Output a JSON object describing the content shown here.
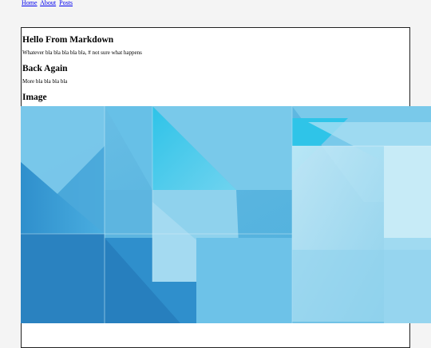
{
  "nav": {
    "links": [
      "Home",
      "About",
      "Posts"
    ]
  },
  "post": {
    "heading1": "Hello From Markdown",
    "paragraph1": "Whatever bla bla bla bla bla, # not sure what happens",
    "heading2": "Back Again",
    "paragraph2": "More bla bla bla bla",
    "heading3": "Image"
  },
  "image": {
    "icon": "abstract-geometric-blue-image",
    "colors": {
      "base": "#58b4df",
      "light": "#8fd2ed",
      "pale": "#bfe7f6",
      "deep": "#2e86c4",
      "cyan": "#3cc6e6",
      "ice": "#d9f0f8"
    }
  }
}
